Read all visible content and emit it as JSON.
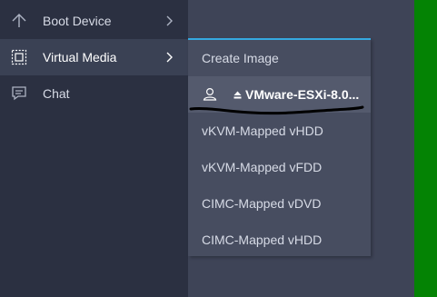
{
  "menu": {
    "items": [
      {
        "label": "Boot Device",
        "icon": "arrow-up-icon",
        "has_submenu": true
      },
      {
        "label": "Virtual Media",
        "icon": "virtual-media-icon",
        "has_submenu": true,
        "active": true
      },
      {
        "label": "Chat",
        "icon": "chat-icon",
        "has_submenu": false
      }
    ]
  },
  "submenu": {
    "create_image": "Create Image",
    "mapped_image": {
      "icon": "user-icon",
      "eject_icon": "eject-icon",
      "label": "VMware-ESXi-8.0..."
    },
    "items": [
      {
        "label": "vKVM-Mapped vHDD"
      },
      {
        "label": "vKVM-Mapped vFDD"
      },
      {
        "label": "CIMC-Mapped vDVD"
      },
      {
        "label": "CIMC-Mapped vHDD"
      }
    ]
  },
  "colors": {
    "menu_bg": "#2b3041",
    "active_bg": "#3a4154",
    "submenu_bg": "#474d60",
    "submenu_selected_bg": "#545a6d",
    "accent": "#35a9e0",
    "green_edge": "#048304"
  }
}
